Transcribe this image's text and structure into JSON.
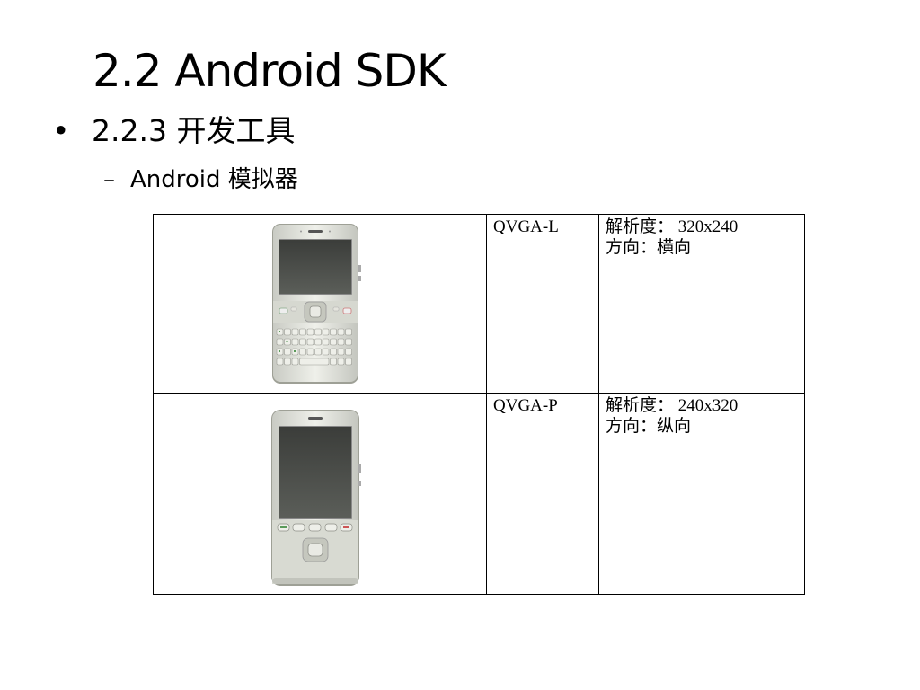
{
  "slide": {
    "title": "2.2 Android SDK",
    "bullet_level1": "2.2.3  开发工具",
    "bullet_level2": "Android 模拟器"
  },
  "emulator_table": {
    "rows": [
      {
        "image": "landscape-qwerty-phone",
        "skin": "QVGA-L",
        "resolution": "解析度： 320x240",
        "orientation": "方向：横向"
      },
      {
        "image": "portrait-phone",
        "skin": "QVGA-P",
        "resolution": "解析度： 240x320",
        "orientation": "方向：纵向"
      }
    ]
  }
}
